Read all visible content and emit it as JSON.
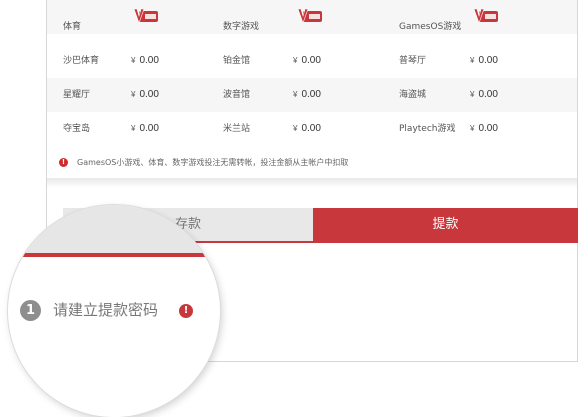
{
  "balances": {
    "rows": [
      [
        {
          "label": "体育",
          "badge": true
        },
        {
          "label": "数字游戏",
          "badge": true
        },
        {
          "label": "GamesOS游戏",
          "badge": true
        }
      ],
      [
        {
          "label": "沙巴体育",
          "currency": "¥",
          "value": "0.00"
        },
        {
          "label": "铂金馆",
          "currency": "¥",
          "value": "0.00"
        },
        {
          "label": "普琴厅",
          "currency": "¥",
          "value": "0.00"
        }
      ],
      [
        {
          "label": "星耀厅",
          "currency": "¥",
          "value": "0.00"
        },
        {
          "label": "波音馆",
          "currency": "¥",
          "value": "0.00"
        },
        {
          "label": "海盗城",
          "currency": "¥",
          "value": "0.00"
        }
      ],
      [
        {
          "label": "夺宝岛",
          "currency": "¥",
          "value": "0.00"
        },
        {
          "label": "米兰站",
          "currency": "¥",
          "value": "0.00"
        },
        {
          "label": "Playtech游戏",
          "currency": "¥",
          "value": "0.00"
        }
      ]
    ]
  },
  "notice": {
    "text": "GamesOS小游戏、体育、数字游戏投注无需转帐，投注金额从主帐户中扣取"
  },
  "tabs": {
    "deposit": "存款",
    "withdraw": "提款"
  },
  "step": {
    "number": "1",
    "label": "请建立提款密码"
  },
  "colors": {
    "accent": "#c8373b",
    "tab_inactive": "#e8e8e8",
    "step_circle": "#8e8e8e"
  },
  "icons": {
    "badge": "v-badge-icon",
    "notice": "alert-icon",
    "warn": "alert-icon"
  }
}
